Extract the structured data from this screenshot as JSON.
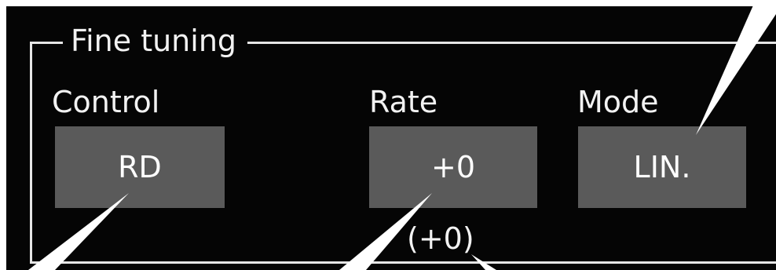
{
  "panel": {
    "group_title": "Fine tuning",
    "control": {
      "label": "Control",
      "value": "RD"
    },
    "rate": {
      "label": "Rate",
      "value": "+0",
      "subvalue": "(+0)"
    },
    "mode": {
      "label": "Mode",
      "value": "LIN."
    }
  },
  "colors": {
    "screen_bg": "#050505",
    "button_bg": "#5a5a5a",
    "text": "#f2f2f2",
    "frame": "#e6e6e6",
    "callout": "#ffffff"
  }
}
